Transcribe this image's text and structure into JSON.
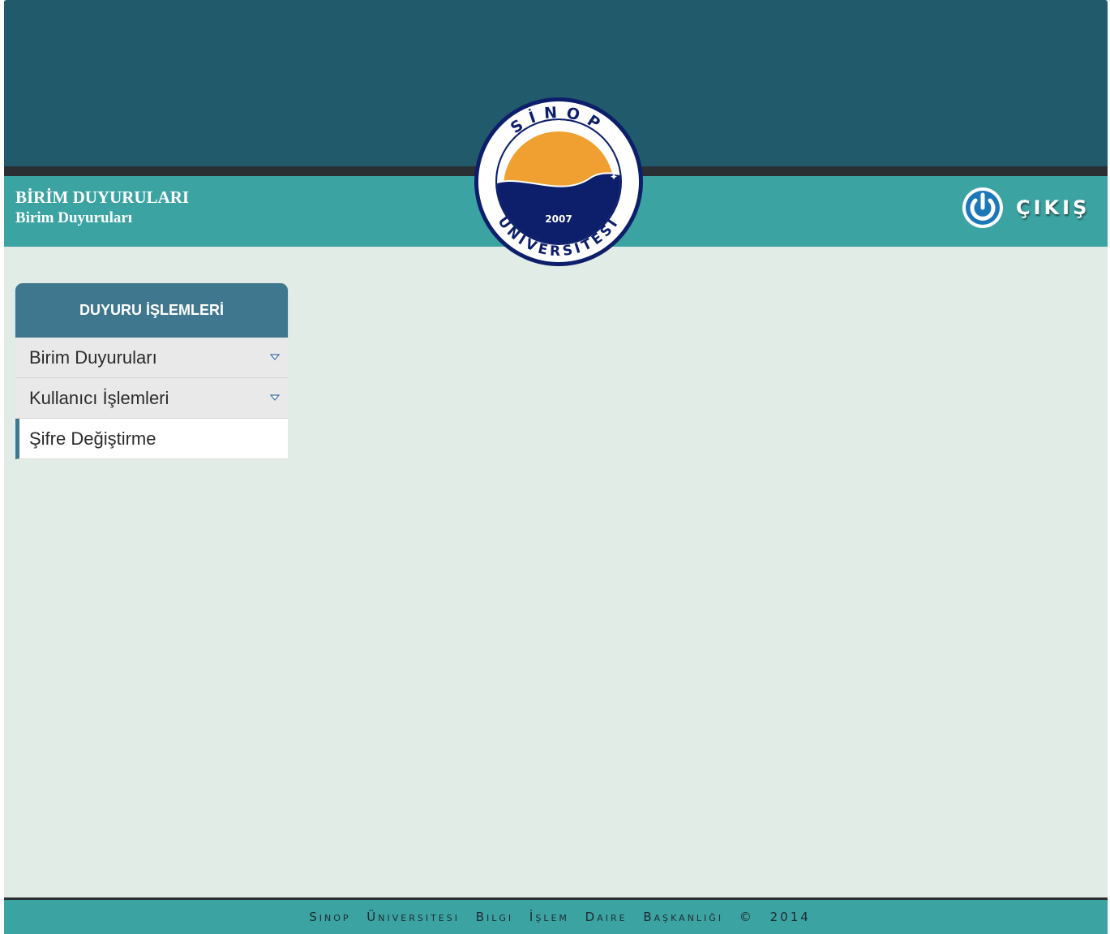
{
  "header": {
    "title": "BİRİM DUYURULARI",
    "subtitle": "Birim Duyuruları",
    "logout_label": "ÇIKIŞ"
  },
  "logo": {
    "top_text": "SİNOP",
    "bottom_text": "ÜNİVERSİTESİ",
    "year": "2007"
  },
  "sidebar": {
    "header": "DUYURU İŞLEMLERİ",
    "items": [
      {
        "label": "Birim Duyuruları",
        "icon": "chevron-down-icon",
        "expandable": true
      },
      {
        "label": "Kullanıcı İşlemleri",
        "icon": "chevron-down-icon",
        "expandable": true
      },
      {
        "label": "Şifre Değiştirme",
        "active": true
      }
    ]
  },
  "footer": {
    "text": "Sinop Üniversitesi Bilgi İşlem Daire Başkanlığı © 2014"
  },
  "colors": {
    "top_band": "#215a6b",
    "teal": "#3ca3a3",
    "sidebar_header": "#3f788e",
    "content_bg": "#e1ece6",
    "logo_navy": "#0d1f6b",
    "logo_orange": "#f0a030"
  }
}
